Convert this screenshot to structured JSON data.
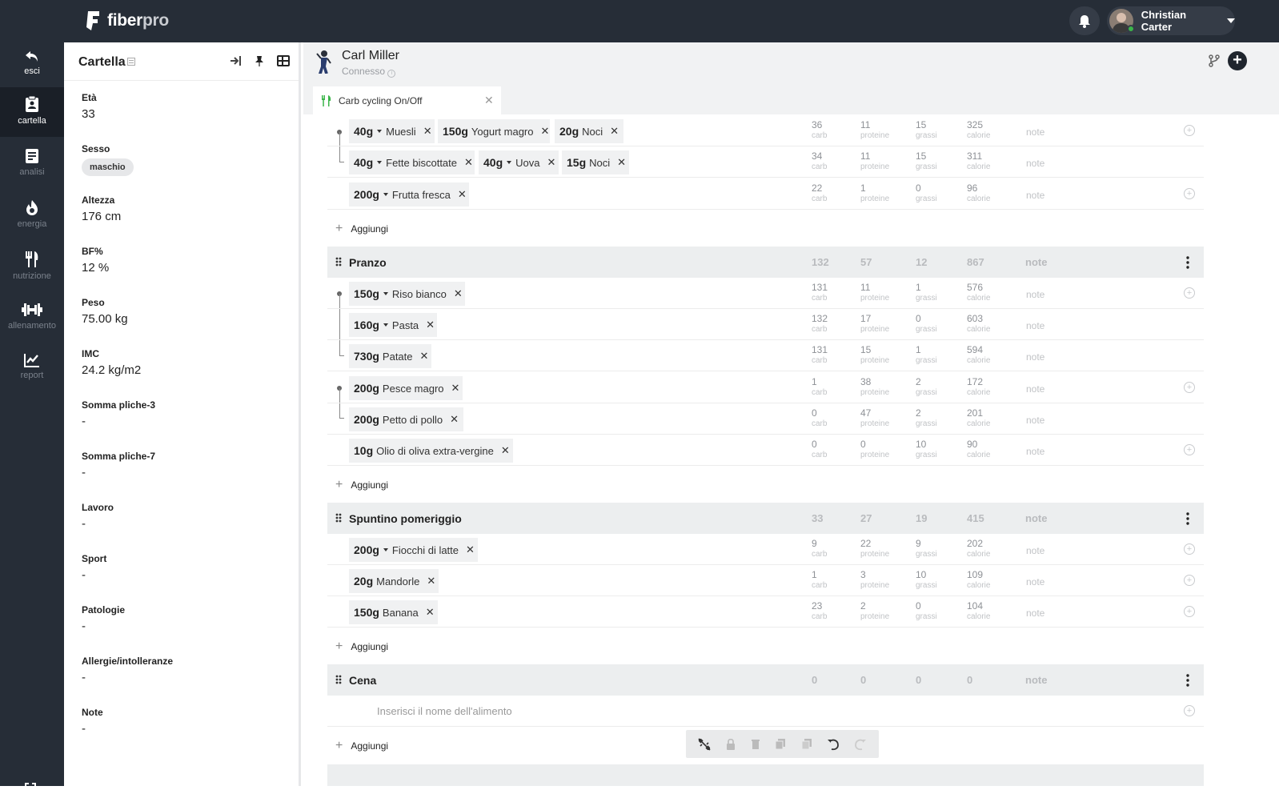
{
  "app": {
    "brand_main": "fiber",
    "brand_accent": "pro",
    "user_name": "Christian Carter"
  },
  "sidebar": {
    "items": [
      {
        "label": "esci",
        "icon": "back-arrow-icon"
      },
      {
        "label": "cartella",
        "icon": "clipboard-icon"
      },
      {
        "label": "analisi",
        "icon": "document-icon"
      },
      {
        "label": "energia",
        "icon": "flame-icon"
      },
      {
        "label": "nutrizione",
        "icon": "fork-knife-icon"
      },
      {
        "label": "allenamento",
        "icon": "dumbbell-icon"
      },
      {
        "label": "report",
        "icon": "chart-icon"
      }
    ]
  },
  "panel": {
    "title": "Cartella",
    "fields": [
      {
        "label": "Età",
        "value": "33"
      },
      {
        "label": "Sesso",
        "value": "maschio"
      },
      {
        "label": "Altezza",
        "value": "176 cm"
      },
      {
        "label": "BF%",
        "value": "12 %"
      },
      {
        "label": "Peso",
        "value": "75.00 kg"
      },
      {
        "label": "IMC",
        "value": "24.2 kg/m2"
      },
      {
        "label": "Somma pliche-3",
        "value": "-"
      },
      {
        "label": "Somma pliche-7",
        "value": "-"
      },
      {
        "label": "Lavoro",
        "value": "-"
      },
      {
        "label": "Sport",
        "value": "-"
      },
      {
        "label": "Patologie",
        "value": "-"
      },
      {
        "label": "Allergie/intolleranze",
        "value": "-"
      },
      {
        "label": "Note",
        "value": "-"
      }
    ]
  },
  "client": {
    "name": "Carl Miller",
    "status": "Connesso"
  },
  "tab": {
    "label": "Carb cycling On/Off"
  },
  "labels": {
    "carb": "carb",
    "protein": "proteine",
    "fat": "grassi",
    "kcal": "calorie",
    "note": "note",
    "add": "Aggiungi",
    "placeholder": "Inserisci il nome dell'alimento"
  },
  "rows": [
    {
      "chips": [
        {
          "q": "40g",
          "n": "Muesli",
          "dd": true
        },
        {
          "q": "150g",
          "n": "Yogurt magro"
        },
        {
          "q": "20g",
          "n": "Noci"
        }
      ],
      "v": [
        "36",
        "11",
        "15",
        "325"
      ]
    },
    {
      "chips": [
        {
          "q": "40g",
          "n": "Fette biscottate",
          "dd": true
        },
        {
          "q": "40g",
          "n": "Uova",
          "dd": true
        },
        {
          "q": "15g",
          "n": "Noci"
        }
      ],
      "v": [
        "34",
        "11",
        "15",
        "311"
      ]
    },
    {
      "chips": [
        {
          "q": "200g",
          "n": "Frutta fresca",
          "dd": true
        }
      ],
      "v": [
        "22",
        "1",
        "0",
        "96"
      ]
    },
    {
      "chips": [
        {
          "q": "150g",
          "n": "Riso bianco",
          "dd": true
        }
      ],
      "v": [
        "131",
        "11",
        "1",
        "576"
      ]
    },
    {
      "chips": [
        {
          "q": "160g",
          "n": "Pasta",
          "dd": true
        }
      ],
      "v": [
        "132",
        "17",
        "0",
        "603"
      ]
    },
    {
      "chips": [
        {
          "q": "730g",
          "n": "Patate"
        }
      ],
      "v": [
        "131",
        "15",
        "1",
        "594"
      ]
    },
    {
      "chips": [
        {
          "q": "200g",
          "n": "Pesce magro"
        }
      ],
      "v": [
        "1",
        "38",
        "2",
        "172"
      ]
    },
    {
      "chips": [
        {
          "q": "200g",
          "n": "Petto di pollo"
        }
      ],
      "v": [
        "0",
        "47",
        "2",
        "201"
      ]
    },
    {
      "chips": [
        {
          "q": "10g",
          "n": "Olio di oliva extra-vergine"
        }
      ],
      "v": [
        "0",
        "0",
        "10",
        "90"
      ]
    },
    {
      "chips": [
        {
          "q": "200g",
          "n": "Fiocchi di latte",
          "dd": true
        }
      ],
      "v": [
        "9",
        "22",
        "9",
        "202"
      ]
    },
    {
      "chips": [
        {
          "q": "20g",
          "n": "Mandorle"
        }
      ],
      "v": [
        "1",
        "3",
        "10",
        "109"
      ]
    },
    {
      "chips": [
        {
          "q": "150g",
          "n": "Banana"
        }
      ],
      "v": [
        "23",
        "2",
        "0",
        "104"
      ]
    }
  ],
  "meals": [
    {
      "name": "Pranzo",
      "v": [
        "132",
        "57",
        "12",
        "867"
      ]
    },
    {
      "name": "Spuntino pomeriggio",
      "v": [
        "33",
        "27",
        "19",
        "415"
      ]
    },
    {
      "name": "Cena",
      "v": [
        "0",
        "0",
        "0",
        "0"
      ]
    }
  ],
  "colors": {
    "sidebar_bg": "#262d37",
    "accent_green": "#3bb54a",
    "meal_bg": "#eceeef"
  }
}
